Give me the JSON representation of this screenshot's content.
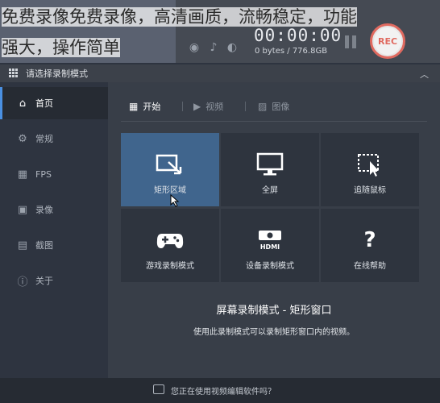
{
  "overlay_caption": [
    "免费录像免费录像，高清画质，流畅稳定，功能",
    "强大，操作简单"
  ],
  "recorder": {
    "timer": "00:00:00",
    "size": "0 bytes / 776.8GB",
    "rec_label": "REC"
  },
  "window": {
    "title": "请选择录制模式"
  },
  "sidebar": {
    "items": [
      {
        "label": "首页",
        "icon": "home-icon"
      },
      {
        "label": "常规",
        "icon": "gear-icon"
      },
      {
        "label": "FPS",
        "icon": "fps-icon"
      },
      {
        "label": "录像",
        "icon": "video-icon"
      },
      {
        "label": "截图",
        "icon": "screenshot-icon"
      },
      {
        "label": "关于",
        "icon": "info-icon"
      }
    ]
  },
  "tabs": [
    {
      "label": "开始",
      "icon": "start-icon"
    },
    {
      "label": "视频",
      "icon": "video-icon"
    },
    {
      "label": "图像",
      "icon": "image-icon"
    }
  ],
  "modes": [
    {
      "label": "矩形区域",
      "icon": "rectangle-region-icon"
    },
    {
      "label": "全屏",
      "icon": "monitor-icon"
    },
    {
      "label": "追随鼠标",
      "icon": "follow-mouse-icon"
    },
    {
      "label": "游戏录制模式",
      "icon": "gamepad-icon"
    },
    {
      "label": "设备录制模式",
      "icon": "hdmi-device-icon"
    },
    {
      "label": "在线帮助",
      "icon": "help-icon"
    }
  ],
  "mode_info": {
    "title": "屏幕录制模式 - 矩形窗口",
    "description": "使用此录制模式可以录制矩形窗口内的视频。"
  },
  "footer": {
    "text": "您正在使用视频编辑软件吗？"
  },
  "colors": {
    "accent": "#4a90e2",
    "active_tile": "#40658d",
    "rec": "#e06a60"
  }
}
